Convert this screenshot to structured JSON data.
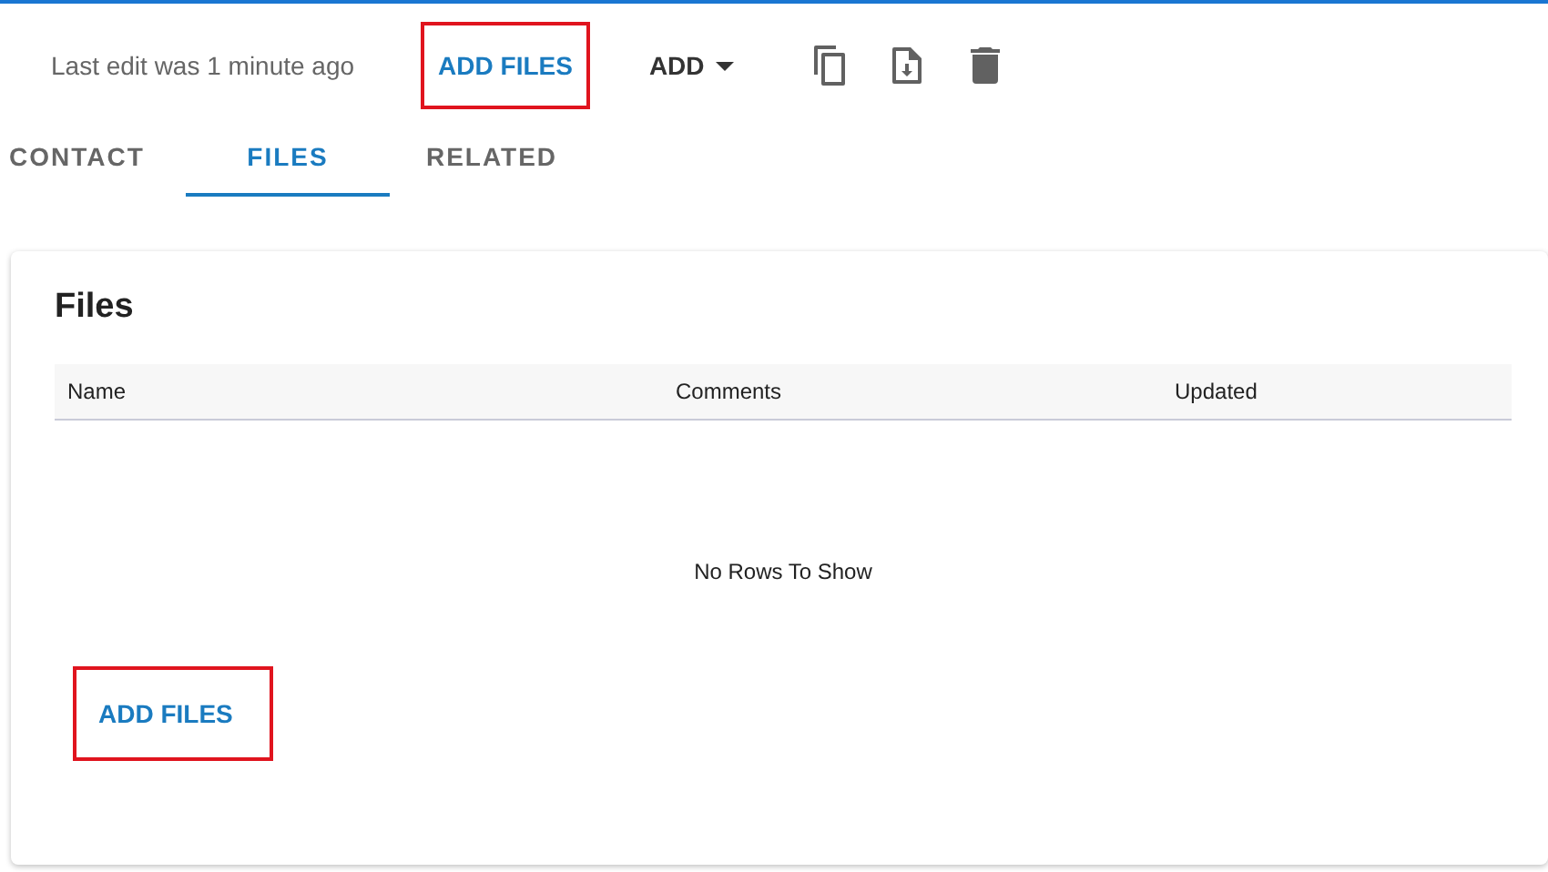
{
  "toolbar": {
    "status": "Last edit was 1 minute ago",
    "buttons": [
      {
        "kind": "text",
        "label": "ADD FILES",
        "highlighted": true
      },
      {
        "kind": "menu",
        "label": "ADD",
        "highlighted": false
      },
      {
        "kind": "copy"
      },
      {
        "kind": "download"
      },
      {
        "kind": "delete"
      }
    ]
  },
  "tabs": [
    {
      "label": "CONTACT",
      "selected": false
    },
    {
      "label": "FILES",
      "selected": true
    },
    {
      "label": "RELATED",
      "selected": false
    }
  ],
  "card": {
    "title": "Files",
    "table": {
      "columns": [
        "Name",
        "Comments",
        "Updated"
      ],
      "empty_message": "No Rows To Show"
    },
    "button": {
      "label": "ADD FILES",
      "highlighted": true
    }
  }
}
